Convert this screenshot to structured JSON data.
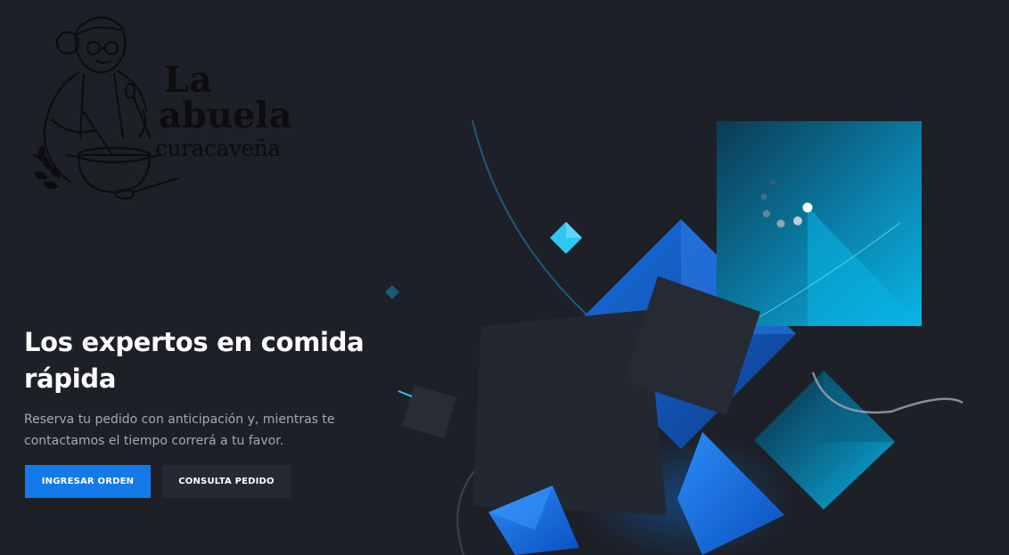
{
  "logo": {
    "line1": "La",
    "line2": "abuela",
    "line3": "curacaveña"
  },
  "hero": {
    "title": "Los expertos en comida rápida",
    "subtitle": "Reserva tu pedido con anticipación y, mientras te contactamos el tiempo correrá a tu favor."
  },
  "buttons": {
    "primary_label": "INGRESAR ORDEN",
    "secondary_label": "CONSULTA PEDIDO"
  },
  "colors": {
    "background": "#1d2027",
    "accent": "#1479e9",
    "secondary_button": "#252932",
    "cyan": "#0fb3e8"
  }
}
